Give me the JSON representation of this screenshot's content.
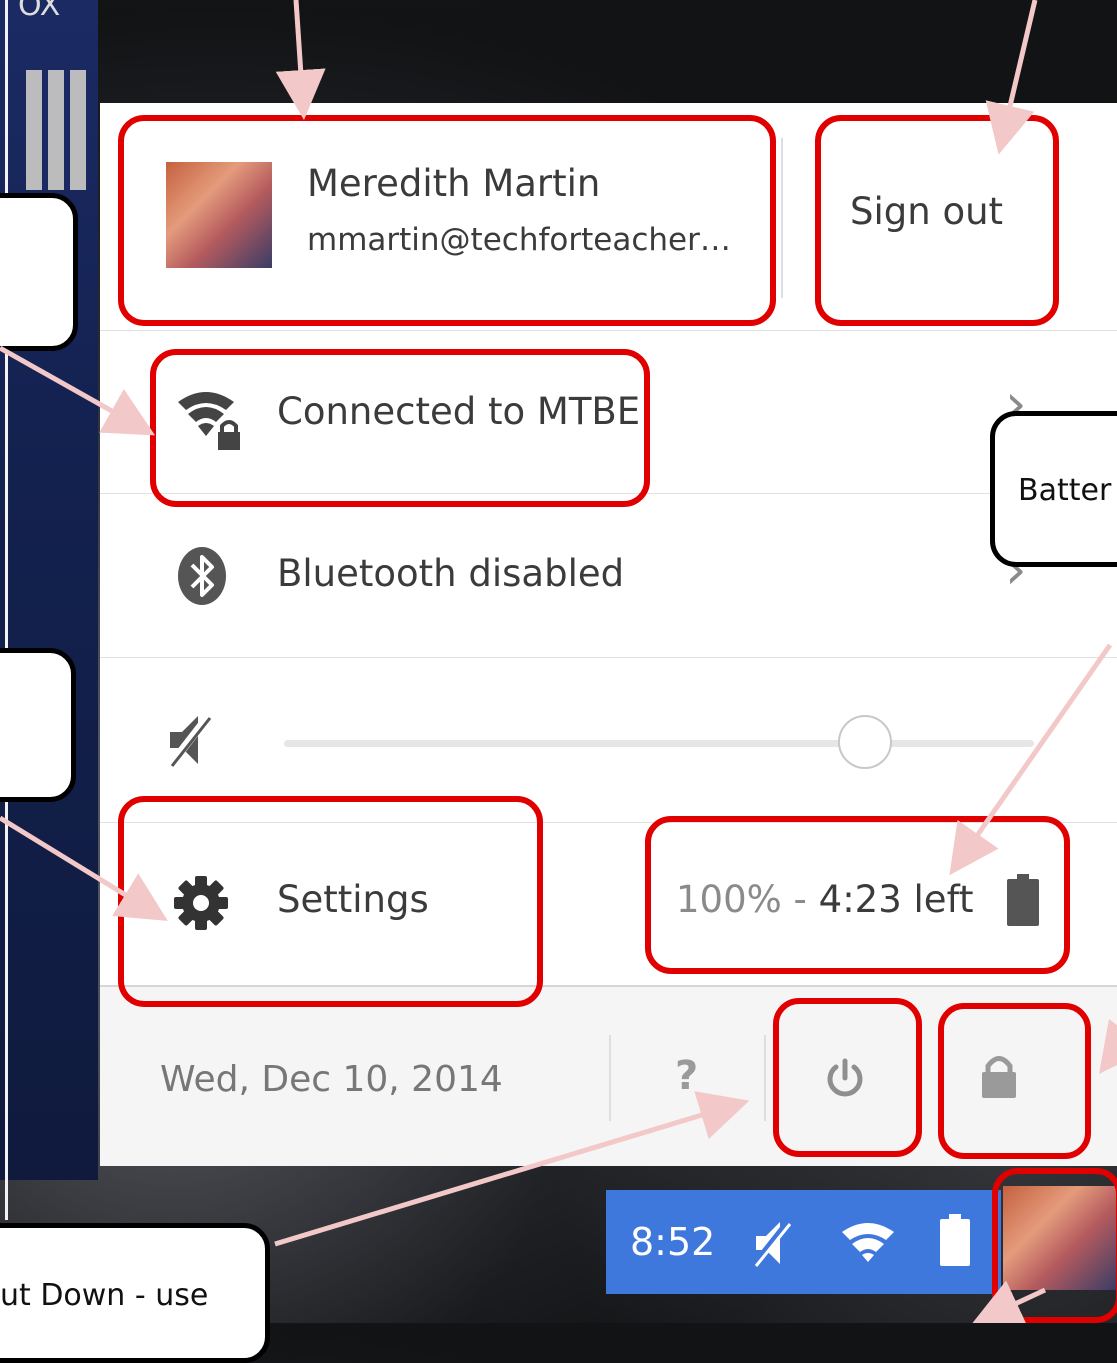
{
  "colors": {
    "accent_red": "#e00000",
    "arrow_pink": "#f2c8c8",
    "tray_blue": "#3e78dc",
    "text": "#3b3b3b"
  },
  "user": {
    "name": "Meredith Martin",
    "email": "mmartin@techforteacher…",
    "avatar_icon": "user-avatar"
  },
  "sign_out": "Sign out",
  "network": {
    "label": "Connected to MTBE",
    "icon": "wifi-lock-icon"
  },
  "bluetooth": {
    "label": "Bluetooth disabled",
    "icon": "bluetooth-icon"
  },
  "volume": {
    "icon": "mute-icon",
    "level": 0.78
  },
  "settings": {
    "label": "Settings",
    "icon": "gear-icon"
  },
  "battery": {
    "percent": "100% -",
    "remaining": "4:23 left",
    "icon": "battery-icon"
  },
  "footer": {
    "date": "Wed, Dec 10, 2014",
    "help": "?",
    "power_icon": "power-icon",
    "lock_icon": "lock-icon"
  },
  "tray": {
    "time": "8:52"
  },
  "callouts": {
    "battery": "Batter",
    "shutdown": "ut Down - use"
  },
  "background": {
    "sign_fragment": "OX"
  }
}
